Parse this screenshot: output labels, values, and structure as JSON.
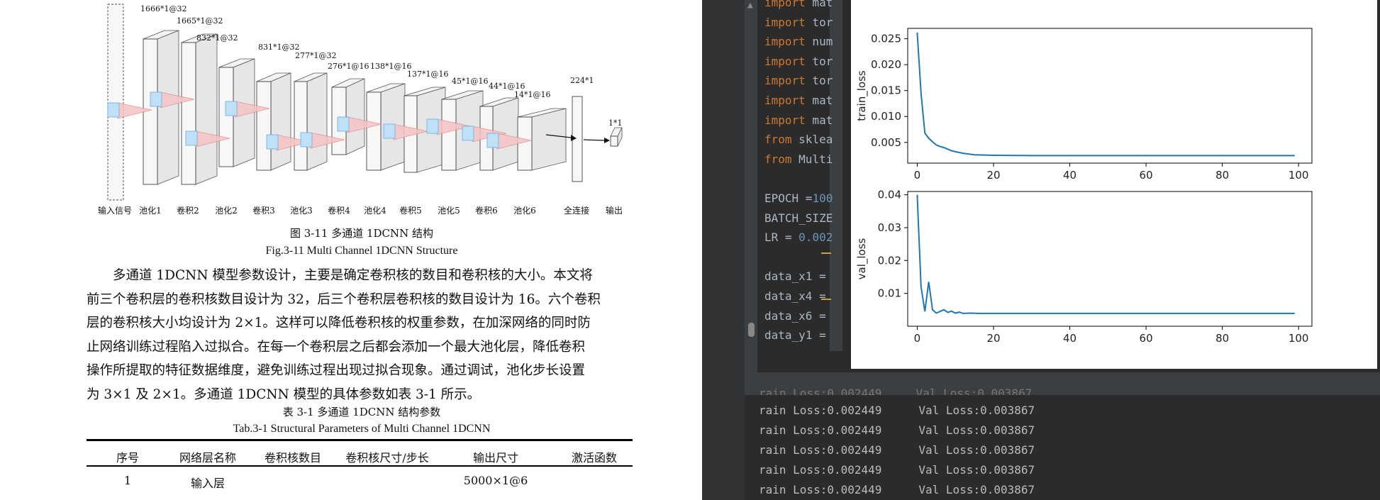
{
  "document": {
    "diagram": {
      "sizes": [
        "1666*1@32",
        "1665*1@32",
        "832*1@32",
        "831*1@32",
        "277*1@32",
        "276*1@16",
        "138*1@16",
        "137*1@16",
        "45*1@16",
        "44*1@16",
        "14*1@16",
        "224*1",
        "1*1"
      ],
      "labels": [
        "输入信号",
        "池化1",
        "卷积2",
        "池化2",
        "卷积3",
        "池化3",
        "卷积4",
        "池化4",
        "卷积5",
        "池化5",
        "卷积6",
        "池化6",
        "全连接",
        "输出"
      ]
    },
    "fig_caption_cn": "图 3-11 多通道 1DCNN 结构",
    "fig_caption_en": "Fig.3-11 Multi Channel 1DCNN Structure",
    "paragraph_lines": [
      "多通道 1DCNN 模型参数设计，主要是确定卷积核的数目和卷积核的大小。本文将",
      "前三个卷积层的卷积核数目设计为 32，后三个卷积层卷积核的数目设计为 16。六个卷积",
      "层的卷积核大小均设计为  2×1。这样可以降低卷积核的权重参数，在加深网络的同时防",
      "止网络训练过程陷入过拟合。在每一个卷积层之后都会添加一个最大池化层，降低卷积",
      "操作所提取的特征数据维度，避免训练过程出现过拟合现象。通过调试，池化步长设置",
      "为 3×1 及 2×1。多通道 1DCNN 模型的具体参数如表 3-1 所示。"
    ],
    "table_caption_cn": "表 3-1 多通道 1DCNN 结构参数",
    "table_caption_en": "Tab.3-1 Structural Parameters of Multi Channel 1DCNN",
    "table_headers": [
      "序号",
      "网络层名称",
      "卷积核数目",
      "卷积核尺寸/步长",
      "输出尺寸",
      "激活函数"
    ],
    "table_row1": [
      "1",
      "输入层",
      "",
      "",
      "5000×1@6",
      ""
    ]
  },
  "ide": {
    "code_lines": [
      {
        "kw": "import",
        "rest": " mat"
      },
      {
        "kw": "import",
        "rest": " tor"
      },
      {
        "kw": "import",
        "rest": " num"
      },
      {
        "kw": "import",
        "rest": " tor"
      },
      {
        "kw": "import",
        "rest": " tor"
      },
      {
        "kw": "import",
        "rest": " mat"
      },
      {
        "kw": "import",
        "rest": " mat"
      },
      {
        "kw": "from",
        "rest": " sklea"
      },
      {
        "kw": "from",
        "rest": " Multi"
      },
      {
        "kw": "",
        "rest": ""
      },
      {
        "kw": "",
        "rest": "EPOCH =",
        "num": "100"
      },
      {
        "kw": "",
        "rest": "BATCH_SIZE"
      },
      {
        "kw": "",
        "rest": "LR = ",
        "num": "0.002"
      },
      {
        "kw": "",
        "rest": ""
      },
      {
        "kw": "",
        "rest": "data_x1 ="
      },
      {
        "kw": "",
        "rest": "data_x4 ="
      },
      {
        "kw": "",
        "rest": "data_x6 ="
      },
      {
        "kw": "",
        "rest": "data_y1 ="
      }
    ],
    "console_lines": [
      {
        "train": "rain Loss:0.002449",
        "val": "Val Loss:0.003867"
      },
      {
        "train": "rain Loss:0.002449",
        "val": "Val Loss:0.003867"
      },
      {
        "train": "rain Loss:0.002449",
        "val": "Val Loss:0.003867"
      },
      {
        "train": "rain Loss:0.002449",
        "val": "Val Loss:0.003867"
      },
      {
        "train": "rain Loss:0.002449",
        "val": "Val Loss:0.003867"
      }
    ],
    "console_partial": "rain Loss:0.002449     Val Loss:0.003867",
    "colors": {
      "keyword": "#cc7832",
      "number": "#6897bb",
      "line": "#1f77b4"
    }
  },
  "chart_data": [
    {
      "type": "line",
      "title": "",
      "xlabel": "",
      "ylabel": "train_loss",
      "xlim": [
        -2.5,
        103.5
      ],
      "ylim": [
        0.001,
        0.027
      ],
      "xticks": [
        0,
        20,
        40,
        60,
        80,
        100
      ],
      "yticks": [
        0.005,
        0.01,
        0.015,
        0.02,
        0.025
      ],
      "ytick_labels": [
        "0.005",
        "0.010",
        "0.015",
        "0.020",
        "0.025"
      ],
      "series": [
        {
          "x": [
            0,
            1,
            2,
            3,
            4,
            5,
            6,
            7,
            8,
            9,
            10,
            12,
            15,
            20,
            30,
            40,
            60,
            80,
            99
          ],
          "y": [
            0.0262,
            0.0145,
            0.0068,
            0.0058,
            0.0051,
            0.0045,
            0.0042,
            0.004,
            0.0037,
            0.0034,
            0.0032,
            0.0029,
            0.0026,
            0.0025,
            0.00245,
            0.00245,
            0.00245,
            0.00245,
            0.00245
          ]
        }
      ]
    },
    {
      "type": "line",
      "title": "",
      "xlabel": "",
      "ylabel": "val_loss",
      "xlim": [
        -2.5,
        103.5
      ],
      "ylim": [
        0.0,
        0.041
      ],
      "xticks": [
        0,
        20,
        40,
        60,
        80,
        100
      ],
      "yticks": [
        0.01,
        0.02,
        0.03,
        0.04
      ],
      "ytick_labels": [
        "0.01",
        "0.02",
        "0.03",
        "0.04"
      ],
      "series": [
        {
          "x": [
            0,
            1,
            2,
            3,
            4,
            5,
            6,
            7,
            8,
            9,
            10,
            11,
            12,
            14,
            16,
            20,
            30,
            40,
            60,
            80,
            99
          ],
          "y": [
            0.04,
            0.012,
            0.0045,
            0.0135,
            0.005,
            0.004,
            0.0045,
            0.005,
            0.0042,
            0.0046,
            0.004,
            0.0043,
            0.0039,
            0.004,
            0.0039,
            0.0039,
            0.0039,
            0.0039,
            0.0039,
            0.0039,
            0.0039
          ]
        }
      ]
    }
  ]
}
